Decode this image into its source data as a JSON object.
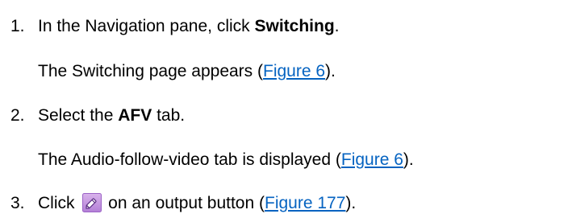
{
  "steps": [
    {
      "number": "1.",
      "text_before": "In the Navigation pane, click ",
      "bold": "Switching",
      "text_after": ".",
      "result": {
        "text_before": "The Switching page appears (",
        "link": "Figure 6",
        "text_after": ")."
      }
    },
    {
      "number": "2.",
      "text_before": "Select the ",
      "bold": "AFV",
      "text_after": " tab.",
      "result": {
        "text_before": "The Audio-follow-video tab is displayed (",
        "link": "Figure 6",
        "text_after": ")."
      }
    },
    {
      "number": "3.",
      "text_before": "Click ",
      "icon": "pencil-edit-icon",
      "text_after": " on an output button (",
      "link": "Figure 177",
      "text_end": ")."
    }
  ],
  "colors": {
    "link": "#0563c1",
    "icon_bg_top": "#d9b3ec",
    "icon_bg_bottom": "#b37fd6",
    "icon_border": "#9b62c6"
  }
}
